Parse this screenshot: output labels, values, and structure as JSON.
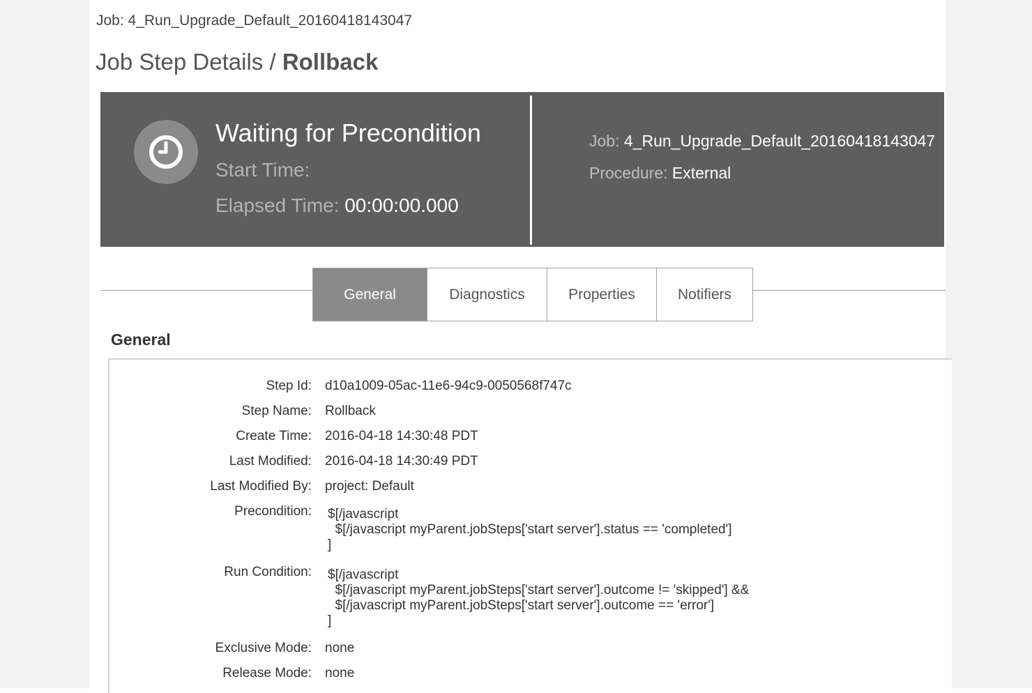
{
  "header": {
    "job_crumb": "Job: 4_Run_Upgrade_Default_20160418143047",
    "title_prefix": "Job Step Details / ",
    "title_step": "Rollback"
  },
  "status": {
    "icon": "clock-icon",
    "title": "Waiting for Precondition",
    "start_time_label": "Start Time:",
    "start_time_value": "",
    "elapsed_label": "Elapsed Time:",
    "elapsed_value": "00:00:00.000",
    "job_label": "Job:",
    "job_value": "4_Run_Upgrade_Default_20160418143047",
    "procedure_label": "Procedure:",
    "procedure_value": "External",
    "panel_color": "#5e5e5e"
  },
  "tabs": [
    {
      "label": "General",
      "active": true
    },
    {
      "label": "Diagnostics",
      "active": false
    },
    {
      "label": "Properties",
      "active": false
    },
    {
      "label": "Notifiers",
      "active": false
    }
  ],
  "general": {
    "heading": "General",
    "fields": [
      {
        "label": "Step Id:",
        "value": "d10a1009-05ac-11e6-94c9-0050568f747c"
      },
      {
        "label": "Step Name:",
        "value": "Rollback"
      },
      {
        "label": "Create Time:",
        "value": "2016-04-18 14:30:48 PDT"
      },
      {
        "label": "Last Modified:",
        "value": "2016-04-18 14:30:49 PDT"
      },
      {
        "label": "Last Modified By:",
        "value": "project: Default"
      },
      {
        "label": "Precondition:",
        "value": "$[/javascript\n  $[/javascript myParent.jobSteps['start server'].status == 'completed']\n]"
      },
      {
        "label": "Run Condition:",
        "value": "$[/javascript\n  $[/javascript myParent.jobSteps['start server'].outcome != 'skipped'] &&\n  $[/javascript myParent.jobSteps['start server'].outcome == 'error']\n]"
      },
      {
        "label": "Exclusive Mode:",
        "value": "none"
      },
      {
        "label": "Release Mode:",
        "value": "none"
      }
    ]
  }
}
